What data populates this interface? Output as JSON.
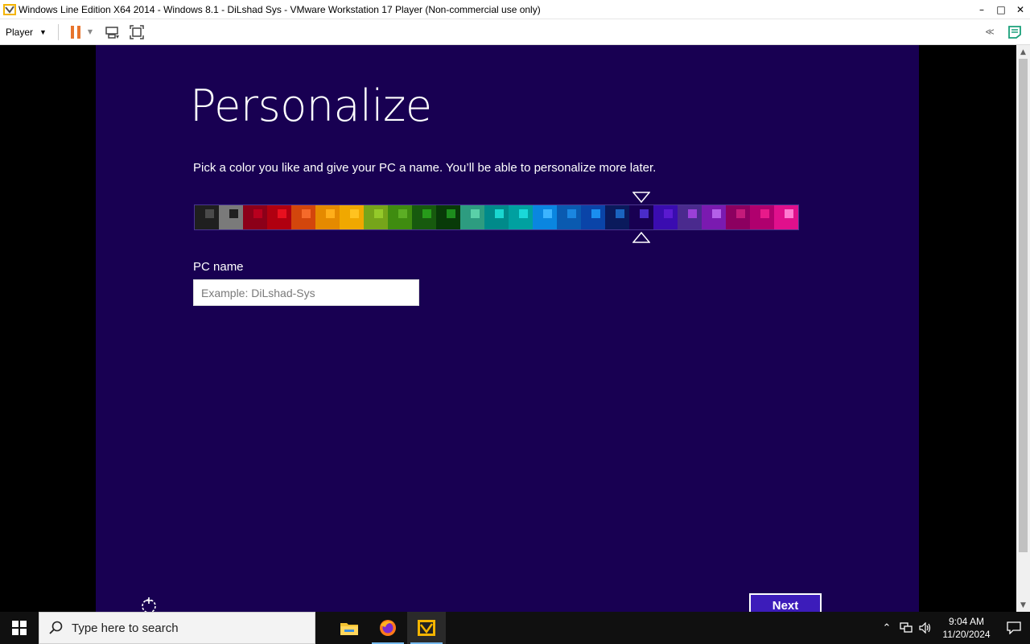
{
  "window": {
    "title": "Windows Line Edition X64 2014 - Windows 8.1 - DiLshad Sys - VMware Workstation 17 Player (Non-commercial use only)",
    "controls": {
      "minimize": "–",
      "maximize": "□",
      "close": "✕"
    }
  },
  "toolbar": {
    "player_label": "Player",
    "pause_color": "#e8742c"
  },
  "guest": {
    "background": "#180052",
    "heading": "Personalize",
    "subtext": "Pick a color you like and give your PC a name. You’ll be able to personalize more later.",
    "selected_swatch_index": 18,
    "swatches": [
      {
        "bg": "#1f1f1f",
        "chip": "#4a4a4a"
      },
      {
        "bg": "#7a7a7a",
        "chip": "#1f1f1f"
      },
      {
        "bg": "#8c0019",
        "chip": "#b8001e"
      },
      {
        "bg": "#b00010",
        "chip": "#e8101e"
      },
      {
        "bg": "#d3460c",
        "chip": "#f56a2a"
      },
      {
        "bg": "#e58a00",
        "chip": "#ffae1a"
      },
      {
        "bg": "#f0a800",
        "chip": "#ffc320"
      },
      {
        "bg": "#76a51a",
        "chip": "#94c92a"
      },
      {
        "bg": "#3f8c10",
        "chip": "#5cae24"
      },
      {
        "bg": "#175a0e",
        "chip": "#279a1a"
      },
      {
        "bg": "#083a08",
        "chip": "#1d8c1d"
      },
      {
        "bg": "#2d9c80",
        "chip": "#5ad0a8"
      },
      {
        "bg": "#008a8a",
        "chip": "#1ad6d0"
      },
      {
        "bg": "#00a0a0",
        "chip": "#1ad8d8"
      },
      {
        "bg": "#0a86e0",
        "chip": "#3cb4ff"
      },
      {
        "bg": "#0a5ab0",
        "chip": "#1a86e0"
      },
      {
        "bg": "#0a44a8",
        "chip": "#1a8ef0"
      },
      {
        "bg": "#0a1a5c",
        "chip": "#1a64c0"
      },
      {
        "bg": "#180052",
        "chip": "#4a2cc8"
      },
      {
        "bg": "#3a0cb0",
        "chip": "#5a1ad0"
      },
      {
        "bg": "#4a2a8e",
        "chip": "#9a40d8"
      },
      {
        "bg": "#7a1ab0",
        "chip": "#b460e8"
      },
      {
        "bg": "#8c0060",
        "chip": "#c41a7a"
      },
      {
        "bg": "#b0006e",
        "chip": "#e81a8a"
      },
      {
        "bg": "#e0108c",
        "chip": "#ff7ad0"
      }
    ],
    "pc_name_label": "PC name",
    "pc_name_placeholder": "Example: DiLshad-Sys",
    "pc_name_value": "",
    "next_label": "Next"
  },
  "taskbar": {
    "search_placeholder": "Type here to search",
    "apps": [
      {
        "name": "file-explorer",
        "running": false
      },
      {
        "name": "firefox",
        "running": true
      },
      {
        "name": "vmware-player",
        "running": true
      }
    ],
    "time": "9:04 AM",
    "date": "11/20/2024"
  }
}
